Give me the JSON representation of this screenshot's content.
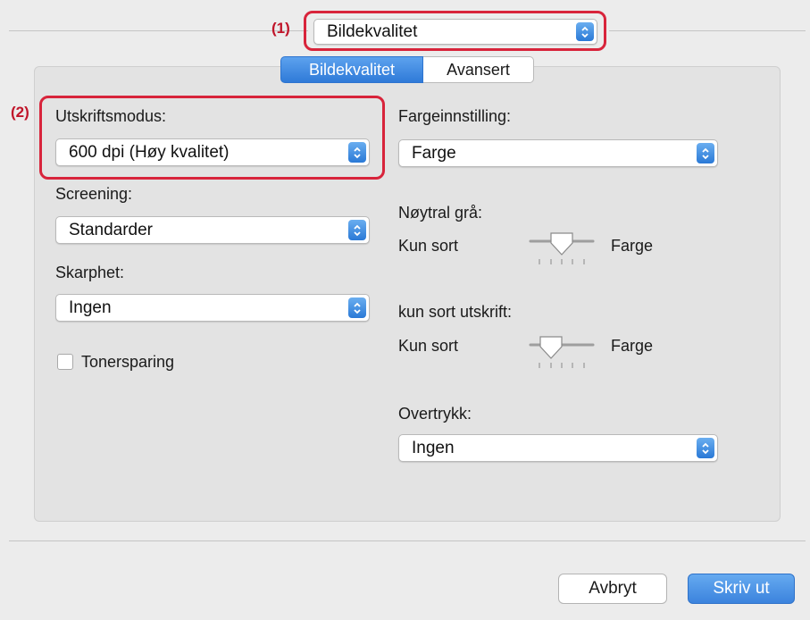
{
  "panel_menu": {
    "callout": "(1)",
    "selected": "Bildekvalitet"
  },
  "tabs": [
    {
      "label": "Bildekvalitet",
      "active": true
    },
    {
      "label": "Avansert",
      "active": false
    }
  ],
  "left": {
    "callout": "(2)",
    "print_mode": {
      "label": "Utskriftsmodus:",
      "value": "600 dpi (Høy kvalitet)"
    },
    "screening": {
      "label": "Screening:",
      "value": "Standarder"
    },
    "sharpness": {
      "label": "Skarphet:",
      "value": "Ingen"
    },
    "toner_save": {
      "label": "Tonersparing",
      "checked": false
    }
  },
  "right": {
    "color_setting": {
      "label": "Fargeinnstilling:",
      "value": "Farge"
    },
    "neutral_gray": {
      "label": "Nøytral grå:",
      "min_label": "Kun sort",
      "max_label": "Farge",
      "level": 0.5
    },
    "black_only_print": {
      "label": "kun sort utskrift:",
      "min_label": "Kun sort",
      "max_label": "Farge",
      "level": 0.33
    },
    "overprint": {
      "label": "Overtrykk:",
      "value": "Ingen"
    }
  },
  "buttons": {
    "cancel": "Avbryt",
    "print": "Skriv ut"
  },
  "colors": {
    "accent": "#3d8ae6",
    "callout_red": "#d8243b",
    "print_button": "#4a90e2"
  }
}
